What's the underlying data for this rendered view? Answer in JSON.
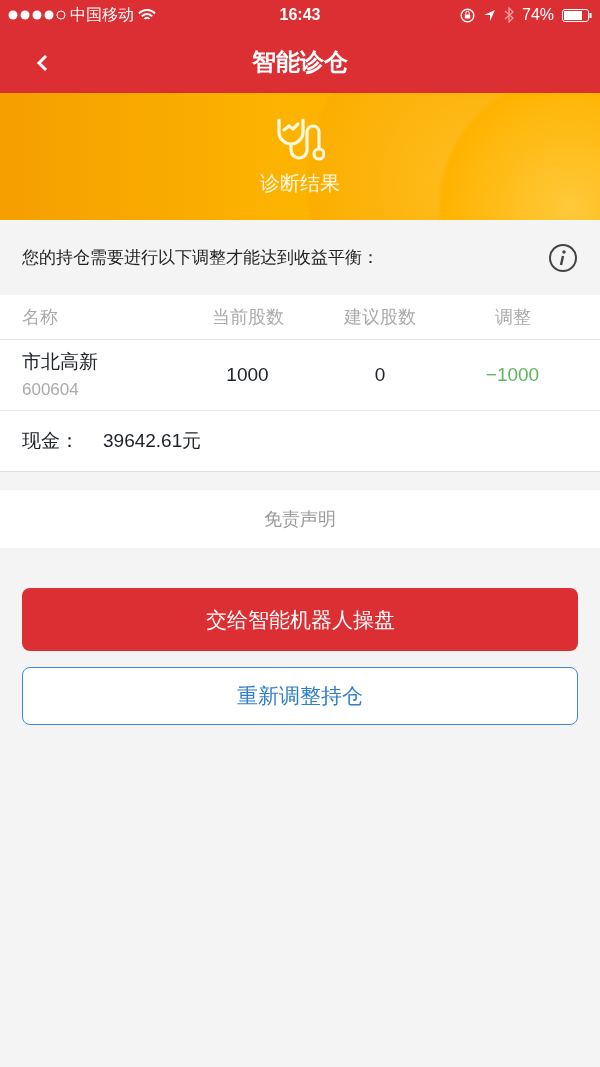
{
  "status_bar": {
    "carrier": "中国移动",
    "time": "16:43",
    "battery": "74%"
  },
  "nav": {
    "title": "智能诊仓"
  },
  "banner": {
    "caption": "诊断结果"
  },
  "notice": {
    "text": "您的持仓需要进行以下调整才能达到收益平衡："
  },
  "table": {
    "columns": [
      "名称",
      "当前股数",
      "建议股数",
      "调整"
    ],
    "rows": [
      {
        "name": "市北高新",
        "code": "600604",
        "current": "1000",
        "suggested": "0",
        "adjust": "−1000",
        "color": "#5cb85c"
      }
    ]
  },
  "cash": {
    "label": "现金：",
    "value": "39642.61元"
  },
  "disclaimer": "免责声明",
  "buttons": [
    {
      "label": "交给智能机器人操盘",
      "kind": "primary"
    },
    {
      "label": "重新调整持仓",
      "kind": "outline"
    }
  ]
}
